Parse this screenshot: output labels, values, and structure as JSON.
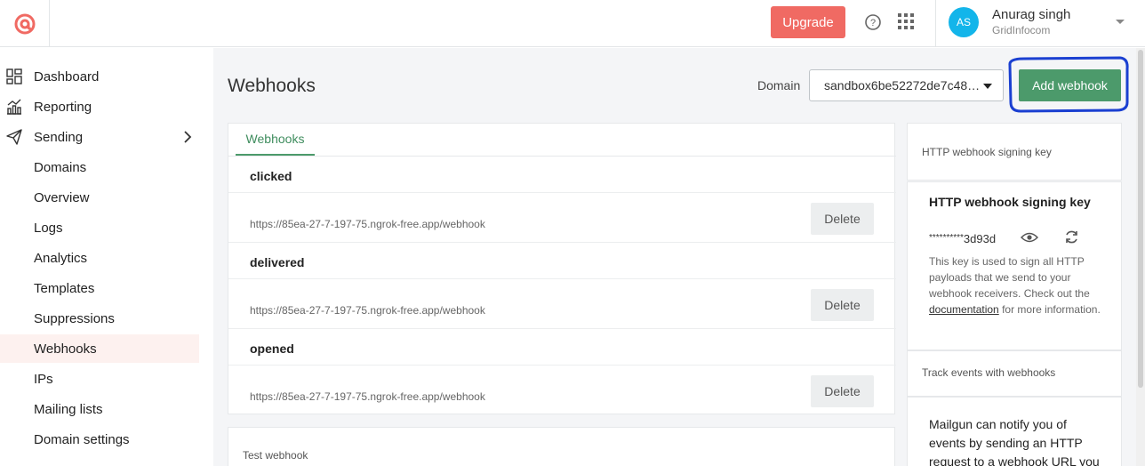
{
  "header": {
    "upgrade_label": "Upgrade",
    "user_initials": "AS",
    "user_name": "Anurag singh",
    "user_org": "GridInfocom"
  },
  "sidebar": {
    "items": [
      {
        "label": "Dashboard",
        "icon": "dashboard-icon"
      },
      {
        "label": "Reporting",
        "icon": "reporting-icon"
      },
      {
        "label": "Sending",
        "icon": "send-icon"
      },
      {
        "label": "Domains"
      },
      {
        "label": "Overview"
      },
      {
        "label": "Logs"
      },
      {
        "label": "Analytics"
      },
      {
        "label": "Templates"
      },
      {
        "label": "Suppressions"
      },
      {
        "label": "Webhooks",
        "active": true
      },
      {
        "label": "IPs"
      },
      {
        "label": "Mailing lists"
      },
      {
        "label": "Domain settings"
      }
    ]
  },
  "main": {
    "title": "Webhooks",
    "domain_label": "Domain",
    "domain_value": "sandbox6be52272de7c48…",
    "add_webhook_label": "Add webhook",
    "tab_label": "Webhooks",
    "webhooks": [
      {
        "event": "clicked",
        "url": "https://85ea-27-7-197-75.ngrok-free.app/webhook",
        "delete_label": "Delete"
      },
      {
        "event": "delivered",
        "url": "https://85ea-27-7-197-75.ngrok-free.app/webhook",
        "delete_label": "Delete"
      },
      {
        "event": "opened",
        "url": "https://85ea-27-7-197-75.ngrok-free.app/webhook",
        "delete_label": "Delete"
      }
    ],
    "test_webhook_title": "Test webhook"
  },
  "side_panel": {
    "signing_header": "HTTP webhook signing key",
    "signing_title": "HTTP webhook signing key",
    "key_masked": "**********",
    "key_suffix": "3d93d",
    "desc_before": "This key is used to sign all HTTP payloads that we send to your webhook receivers. Check out the ",
    "doc_link": "documentation",
    "desc_after": " for more information.",
    "track_header": "Track events with webhooks",
    "track_text": "Mailgun can notify you of events by sending an HTTP request to a webhook URL you"
  },
  "colors": {
    "brand": "#f06a63",
    "accent_green": "#4c9a6b",
    "avatar": "#13b5ea",
    "highlight_ring": "#1a3fd1"
  }
}
